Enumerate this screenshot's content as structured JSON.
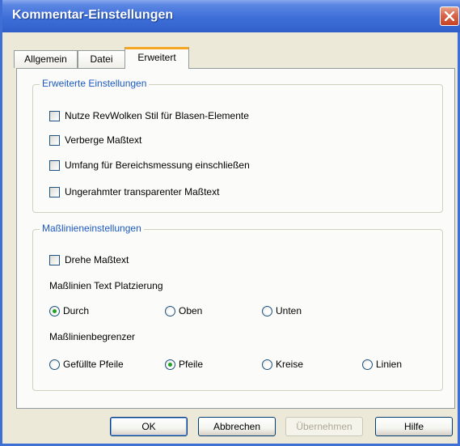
{
  "window": {
    "title": "Kommentar-Einstellungen",
    "close_icon": "close-icon"
  },
  "tabs": [
    {
      "label": "Allgemein",
      "active": false
    },
    {
      "label": "Datei",
      "active": false
    },
    {
      "label": "Erweitert",
      "active": true
    }
  ],
  "advanced": {
    "legend": "Erweiterte Einstellungen",
    "checkboxes": [
      {
        "label": "Nutze RevWolken Stil für Blasen-Elemente",
        "checked": false
      },
      {
        "label": "Verberge Maßtext",
        "checked": false
      },
      {
        "label": "Umfang für Bereichsmessung einschließen",
        "checked": false
      },
      {
        "label": "Ungerahmter transparenter Maßtext",
        "checked": false
      }
    ]
  },
  "dimension": {
    "legend": "Maßlinieneinstellungen",
    "rotate_text": {
      "label": "Drehe Maßtext",
      "checked": false
    },
    "placement_label": "Maßlinien Text Platzierung",
    "placement_options": [
      {
        "label": "Durch",
        "checked": true
      },
      {
        "label": "Oben",
        "checked": false
      },
      {
        "label": "Unten",
        "checked": false
      }
    ],
    "terminator_label": "Maßlinienbegrenzer",
    "terminator_options": [
      {
        "label": "Gefüllte Pfeile",
        "checked": false
      },
      {
        "label": "Pfeile",
        "checked": true
      },
      {
        "label": "Kreise",
        "checked": false
      },
      {
        "label": "Linien",
        "checked": false
      }
    ]
  },
  "buttons": {
    "ok": "OK",
    "cancel": "Abbrechen",
    "apply": "Übernehmen",
    "help": "Hilfe"
  }
}
